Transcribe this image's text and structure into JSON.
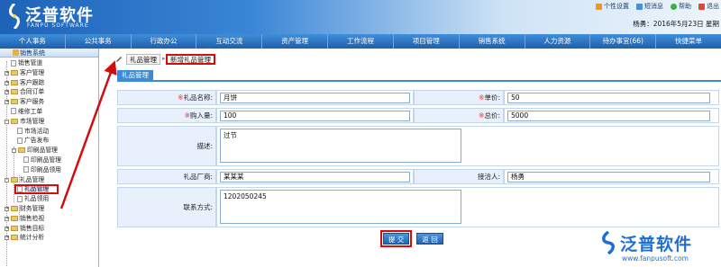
{
  "header": {
    "logo_name": "泛普软件",
    "logo_en": "FANPU SOFTWARE",
    "links": [
      "个性设置",
      "短消息",
      "帮助",
      "退出"
    ],
    "user_line": "杨勇：2016年5月23日 星期"
  },
  "nav": {
    "items": [
      "个人事务",
      "公共事务",
      "行政办公",
      "互动交流",
      "资产管理",
      "工作流程",
      "项目管理",
      "销售系统",
      "人力资源",
      "待办事宜(66)",
      "快捷菜单"
    ]
  },
  "sidebar": {
    "title": "销售系统",
    "nodes": [
      {
        "label": "销售管道"
      },
      {
        "label": "客户管理"
      },
      {
        "label": "客户跟踪"
      },
      {
        "label": "合同订单"
      },
      {
        "label": "客户服务"
      },
      {
        "label": "维修工单"
      },
      {
        "label": "市场管理"
      },
      {
        "label": "市场活动"
      },
      {
        "label": "广告发布"
      },
      {
        "label": "印刷品管理"
      },
      {
        "label": "印刷品管理"
      },
      {
        "label": "印刷品领用"
      },
      {
        "label": "礼品管理"
      },
      {
        "label": "礼品管理"
      },
      {
        "label": "礼品领用"
      },
      {
        "label": "财务管理"
      },
      {
        "label": "销售检视"
      },
      {
        "label": "销售目标"
      },
      {
        "label": "统计分析"
      }
    ]
  },
  "breadcrumb": {
    "tab1": "礼品管理",
    "tab2": "新增礼品管理"
  },
  "section": {
    "title": "礼品管理"
  },
  "form": {
    "req_mark": "※",
    "gift_name_label": "礼品名称:",
    "gift_name_value": "月饼",
    "unit_price_label": "单价:",
    "unit_price_value": "50",
    "quantity_label": "购入量:",
    "quantity_value": "100",
    "total_label": "总价:",
    "total_value": "5000",
    "description_label": "描述:",
    "description_value": "过节",
    "vendor_label": "礼品厂商:",
    "vendor_value": "某某某",
    "contact_person_label": "接洽人:",
    "contact_person_value": "杨勇",
    "contact_info_label": "联系方式:",
    "contact_info_value": "1202050245"
  },
  "buttons": {
    "submit": "提 交",
    "back": "返 回"
  },
  "watermark": {
    "name": "泛普软件",
    "url": "www.fanpusoft.com"
  },
  "colors": {
    "accent": "#3d8ad6",
    "annotation": "#d10d10",
    "label_bg": "#e7f0fb"
  }
}
